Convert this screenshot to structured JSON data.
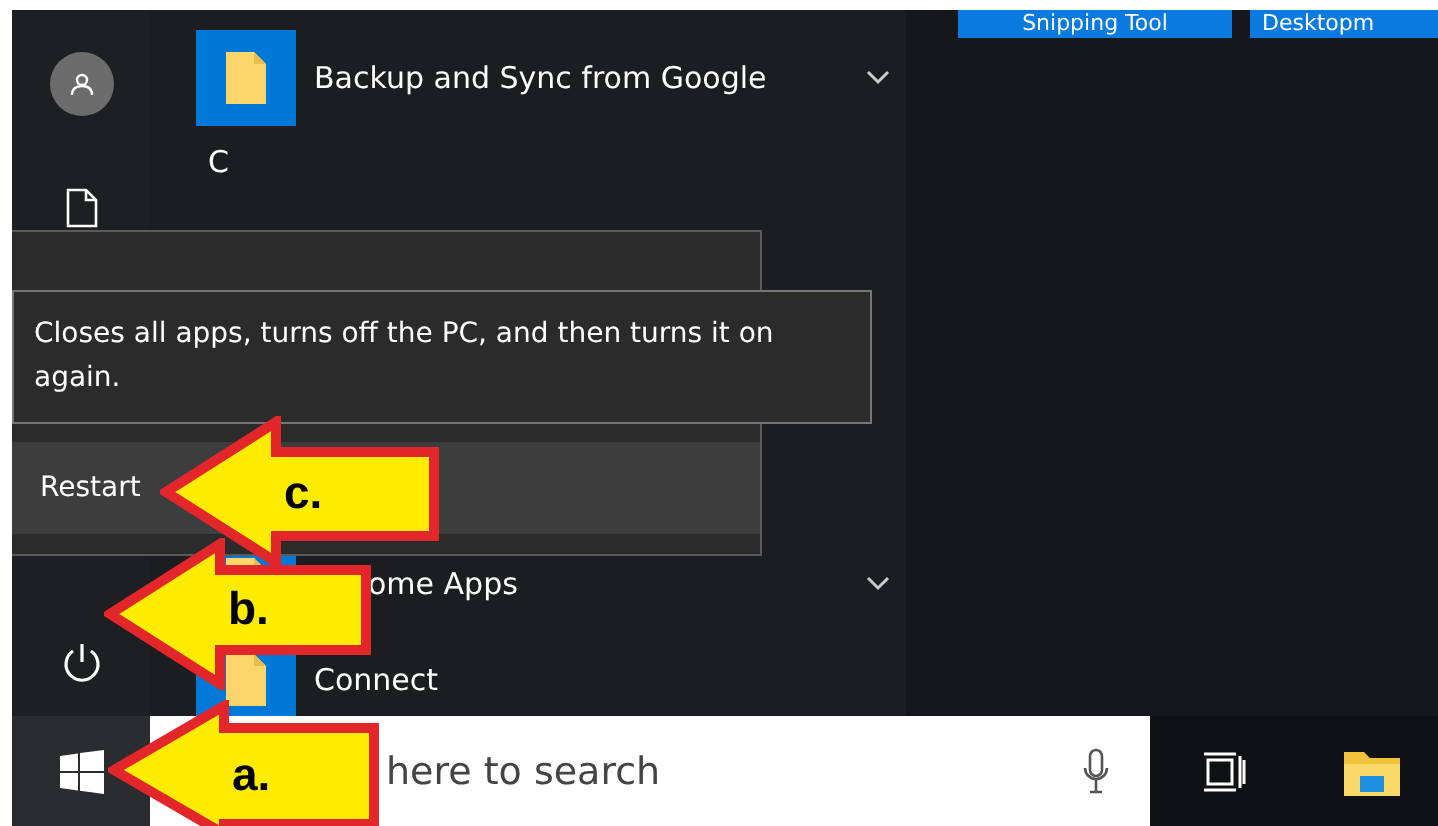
{
  "tiles": [
    {
      "label": "Snipping Tool"
    },
    {
      "label": "Desktopm"
    }
  ],
  "app_list": {
    "top": [
      {
        "kind": "app",
        "name": "Backup and Sync from Google",
        "expandable": true
      },
      {
        "kind": "letter",
        "name": "C",
        "expandable": false
      }
    ],
    "bottom": [
      {
        "kind": "app",
        "name": "ome Apps",
        "expandable": true
      },
      {
        "kind": "app",
        "name": "Connect",
        "expandable": false
      }
    ]
  },
  "power_menu": {
    "items": [
      {
        "label": "Restart",
        "selected": true
      }
    ],
    "tooltip": "Closes all apps, turns off the PC, and then turns it on again."
  },
  "taskbar": {
    "search": {
      "placeholder": "here to search"
    }
  },
  "annotations": [
    {
      "label": "c."
    },
    {
      "label": "b."
    },
    {
      "label": "a."
    }
  ]
}
